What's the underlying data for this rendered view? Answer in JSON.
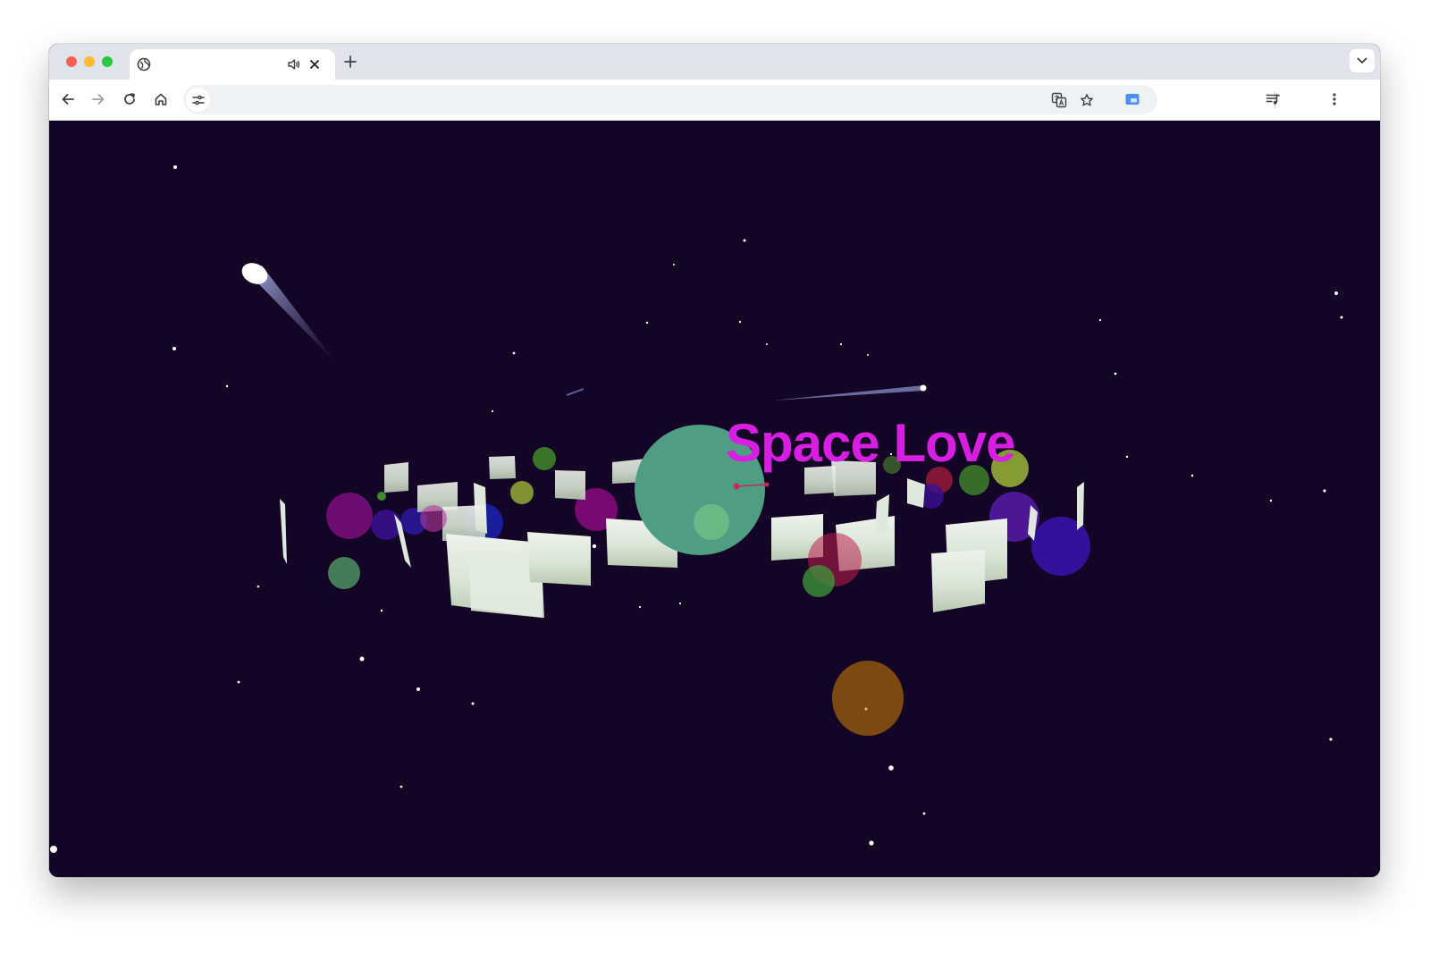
{
  "browser": {
    "tab": {
      "favicon": "globe-icon",
      "audio_icon": "speaker-icon",
      "close_icon": "close-icon"
    },
    "new_tab_icon": "plus-icon",
    "tab_search_icon": "chevron-down-icon",
    "toolbar": {
      "back_icon": "arrow-left-icon",
      "forward_icon": "arrow-right-icon",
      "reload_icon": "reload-icon",
      "home_icon": "home-icon",
      "site_settings_icon": "tune-icon",
      "translate_icon": "translate-icon",
      "bookmark_icon": "star-icon",
      "extension_icon": "extension-window-icon",
      "media_icon": "queue-music-icon",
      "menu_icon": "kebab-menu-icon"
    },
    "traffic_colors": [
      "#ff5f57",
      "#febc2e",
      "#28c840"
    ]
  },
  "scene": {
    "title": "Space Love",
    "title_color": "#d61fe0",
    "background": "#140425"
  }
}
